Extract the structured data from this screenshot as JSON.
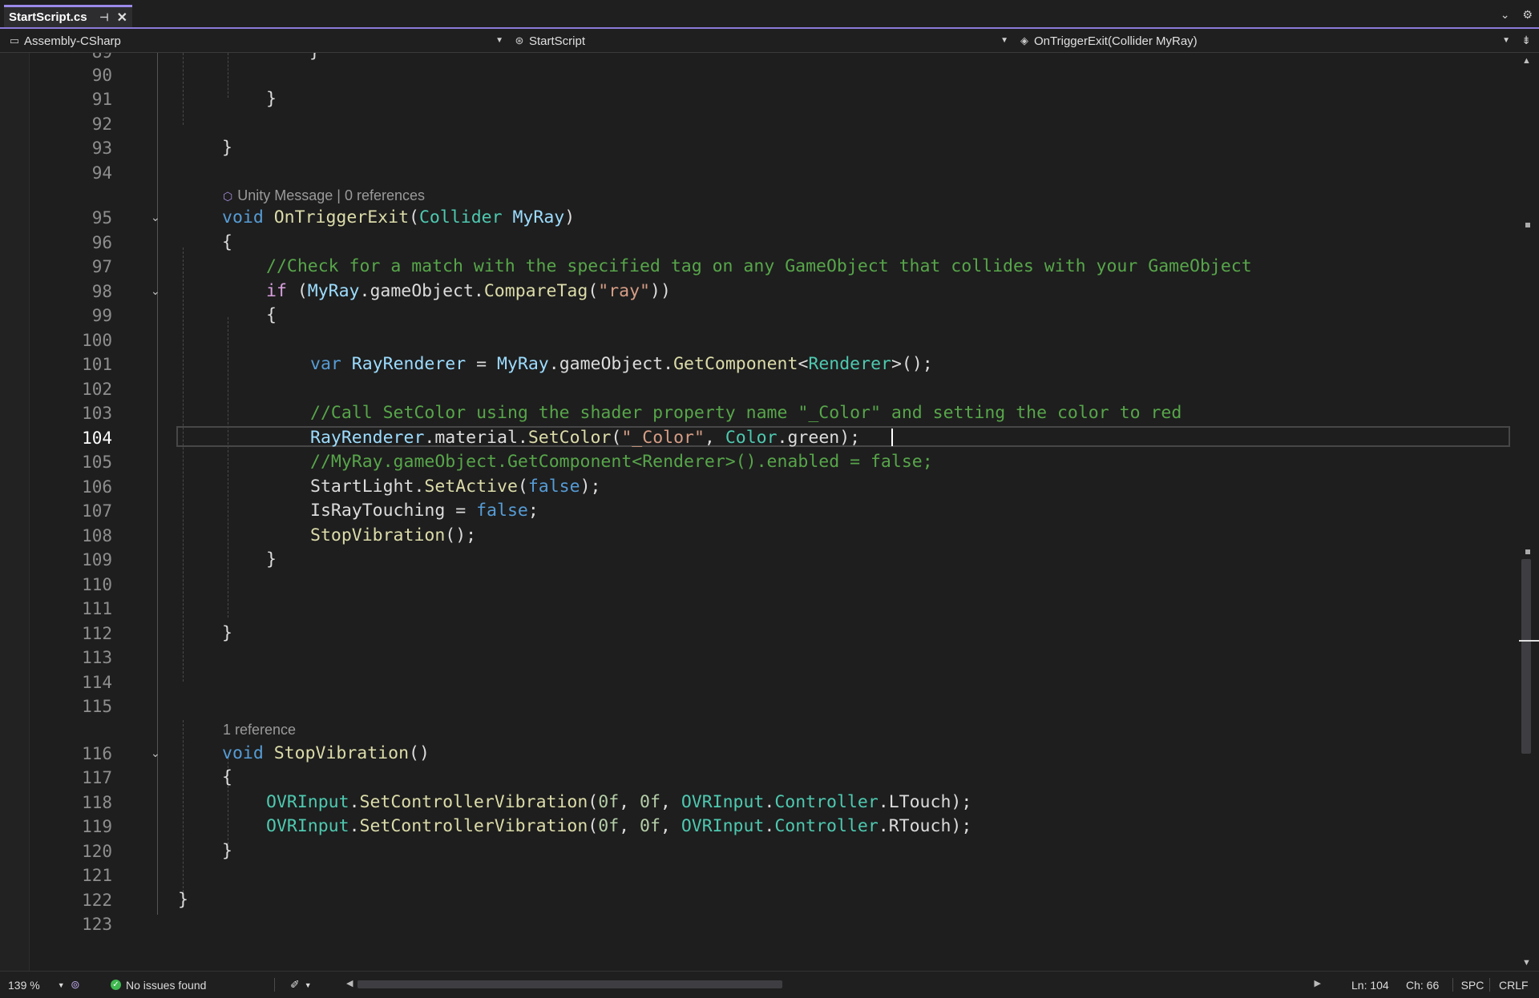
{
  "tab": {
    "title": "StartScript.cs",
    "pin_icon": "⊣",
    "close_icon": "✕"
  },
  "tab_right": {
    "dropdown_icon": "⌄",
    "gear_icon": "⚙"
  },
  "nav": {
    "project": "Assembly-CSharp",
    "class": "StartScript",
    "member": "OnTriggerExit(Collider MyRay)"
  },
  "editor": {
    "current_line": 104,
    "codelens": [
      {
        "text": "Unity Message | 0 references",
        "before_line": 95
      },
      {
        "text": "1 reference",
        "before_line": 116
      }
    ]
  },
  "status": {
    "zoom": "139 %",
    "issues": "No issues found",
    "ln": "Ln: 104",
    "ch": "Ch: 66",
    "indent": "SPC",
    "eol": "CRLF"
  }
}
